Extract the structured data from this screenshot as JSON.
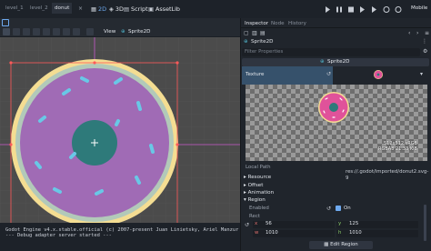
{
  "scene_tabs": [
    "level_1",
    "level_2",
    "donut"
  ],
  "workspaces": [
    {
      "icon": "2D",
      "label": "2D",
      "active": true
    },
    {
      "icon": "3D",
      "label": "3D",
      "active": false
    },
    {
      "icon": "script-icon",
      "label": "Script",
      "active": false
    },
    {
      "icon": "assetlib-icon",
      "label": "AssetLib",
      "active": false
    }
  ],
  "renderer_label": "Mobile",
  "toolbar": {
    "view_label": "View",
    "node_label": "Sprite2D"
  },
  "dock_tabs": [
    "Inspector",
    "Node",
    "History"
  ],
  "inspector": {
    "object_label": "Sprite2D",
    "filter_placeholder": "Filter Properties",
    "class_header": "Sprite2D",
    "texture_label": "Texture",
    "preview_info_line1": "512x512 sRGB",
    "preview_info_line2": "RGBA8 21.33 KiB",
    "local_path_label": "Local Path",
    "local_path_value": "res://.godot/imported/donut2.svg-9",
    "resource_label": "Resource",
    "sections": [
      "Offset",
      "Animation",
      "Region"
    ],
    "region": {
      "enabled_label": "Enabled",
      "enabled_value": "On",
      "rect_label": "Rect",
      "x": "56",
      "y": "125",
      "w": "1010",
      "h": "1010"
    },
    "edit_region_label": "Edit Region"
  },
  "console": {
    "line1": "Godot Engine v4.x.stable.official (c) 2007-present Juan Linietsky, Ariel Manzur & Godot Contributors.",
    "line2": "--- Debug adapter server started ---"
  },
  "colors": {
    "accent": "#6eaaf0",
    "donut_icing": "#a06bb5",
    "donut_dough": "#f0d890",
    "donut_hole": "#2e7a7a",
    "selection": "#ff5a5a"
  }
}
